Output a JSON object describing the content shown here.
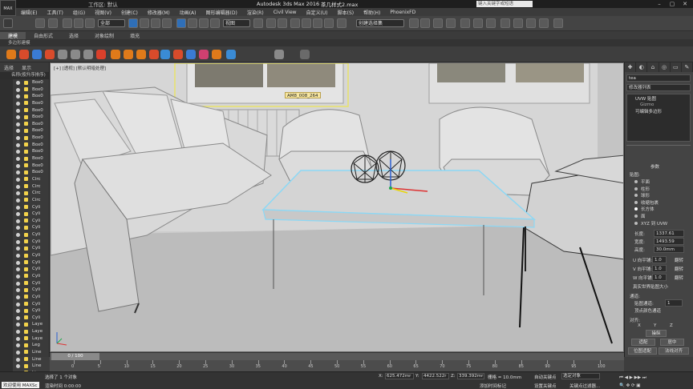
{
  "title_bar": {
    "workspace": "工作区: 默认",
    "app_title": "Autodesk 3ds Max 2016",
    "file_name": "茶几样式2.max",
    "search_placeholder": "键入关键字或短语",
    "app_icon_label": "MAX"
  },
  "menubar": {
    "items": [
      "编辑(E)",
      "工具(T)",
      "组(G)",
      "视图(V)",
      "创建(C)",
      "修改器(M)",
      "动画(A)",
      "图形编辑器(D)",
      "渲染(R)",
      "Civil View",
      "自定义(U)",
      "脚本(S)",
      "帮助(H)",
      "PhoenixFD"
    ]
  },
  "toolbar": {
    "selection_filter": "全部",
    "ref_coord": "视图",
    "named_selection": "创建选择集"
  },
  "ribbon": {
    "tabs": [
      "建模",
      "自由形式",
      "选择",
      "对象绘制",
      "填充"
    ],
    "sub_label": "多边形建模"
  },
  "scene_explorer": {
    "tabs": [
      "选择",
      "显示"
    ],
    "header": "名称(按升序排序)",
    "items": [
      "Box0",
      "Box0",
      "Box0",
      "Box0",
      "Box0",
      "Box0",
      "Box0",
      "Box0",
      "Box0",
      "Box0",
      "Box0",
      "Box0",
      "Box0",
      "Box0",
      "Circ",
      "Circ",
      "Circ",
      "Circ",
      "Cyli",
      "Cyli",
      "Cyli",
      "Cyli",
      "Cyli",
      "Cyli",
      "Cyli",
      "Cyli",
      "Cyli",
      "Cyli",
      "Cyli",
      "Cyli",
      "Cyli",
      "Cyli",
      "Cyli",
      "Cyli",
      "Cyli",
      "Laye",
      "Laye",
      "Laye",
      "Leg",
      "Line",
      "Line",
      "Line",
      "Line"
    ]
  },
  "viewport": {
    "label": "[+] [透视] [默认明暗处理]",
    "object_tooltip": "AM8_008_264"
  },
  "command_panel": {
    "object_name": "tea",
    "modifier_list": "修改器列表",
    "stack": [
      "UVW 贴图",
      "Gizmo",
      "可编辑多边形"
    ],
    "params_title": "参数",
    "mapping_label": "贴图:",
    "mapping_types": [
      "平面",
      "柱形",
      "球形",
      "收缩包裹",
      "长方体",
      "面",
      "XYZ 到 UVW"
    ],
    "length_label": "长度:",
    "length_value": "1337.61",
    "width_label": "宽度:",
    "width_value": "1493.59",
    "height_label": "高度:",
    "height_value": "30.0mm",
    "u_tile_label": "U 向平铺:",
    "u_tile_value": "1.0",
    "v_tile_label": "V 向平铺:",
    "v_tile_value": "1.0",
    "w_tile_label": "W 向平铺:",
    "w_tile_value": "1.0",
    "flip_label": "翻转",
    "real_world_label": "真实世界贴图大小",
    "channel_section": "通道:",
    "map_channel_label": "贴图通道:",
    "map_channel_value": "1",
    "vertex_color_label": "顶点颜色通道",
    "align_section": "对齐:",
    "axes": [
      "X",
      "Y",
      "Z"
    ],
    "buttons": [
      "操纵",
      "适配",
      "居中",
      "位图适配",
      "法线对齐",
      "视图对齐",
      "区域适配"
    ]
  },
  "timeline": {
    "frame_display": "0 / 100",
    "ticks": [
      "0",
      "5",
      "10",
      "15",
      "20",
      "25",
      "30",
      "35",
      "40",
      "45",
      "50",
      "55",
      "60",
      "65",
      "70",
      "75",
      "80",
      "85",
      "90",
      "95",
      "100"
    ]
  },
  "status": {
    "welcome": "欢迎使用 MAXSc",
    "selection_info": "选择了 1 个对象",
    "prompt": "渲染时间  0:00:00",
    "x_label": "X:",
    "x_value": "625.472mr",
    "y_label": "Y:",
    "y_value": "4422.522r",
    "z_label": "Z:",
    "z_value": "339.392mr",
    "grid": "栅格 = 10.0mm",
    "add_time_tag": "添加时间标记",
    "auto_key": "自动关键点",
    "set_key": "设置关键点",
    "selected_set": "选定对象",
    "key_filter": "关键点过滤器..."
  }
}
